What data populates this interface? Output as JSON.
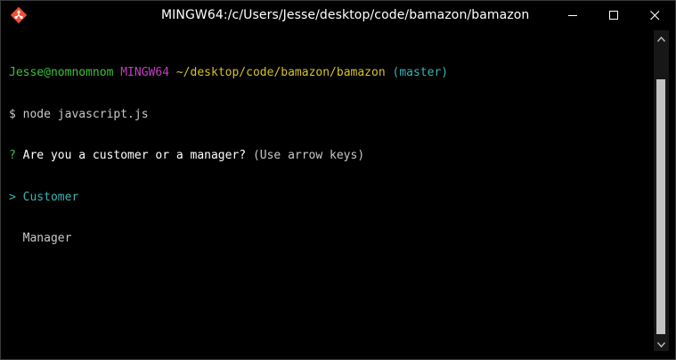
{
  "window": {
    "title": "MINGW64:/c/Users/Jesse/desktop/code/bamazon/bamazon"
  },
  "icons": {
    "app": "git-diamond-icon",
    "minimize": "minimize-icon",
    "maximize": "maximize-icon",
    "close": "close-icon",
    "scroll_up": "chevron-up-icon",
    "scroll_down": "chevron-down-icon"
  },
  "terminal": {
    "prompt": {
      "user_host": "Jesse@nomnomnom",
      "system": "MINGW64",
      "path": "~/desktop/code/bamazon/bamazon",
      "branch": "(master)"
    },
    "command": {
      "symbol": "$",
      "text": "node javascript.js"
    },
    "question": {
      "marker": "?",
      "text": "Are you a customer or a manager?",
      "hint": "(Use arrow keys)"
    },
    "choices": [
      {
        "pointer": ">",
        "label": "Customer",
        "selected": true
      },
      {
        "pointer": " ",
        "label": "Manager",
        "selected": false
      }
    ]
  },
  "colors": {
    "background": "#000000",
    "user_host": "#3cc23c",
    "system": "#bf3fbf",
    "path": "#d6c12a",
    "branch": "#3ab3b3",
    "selected": "#3ab3b3"
  }
}
